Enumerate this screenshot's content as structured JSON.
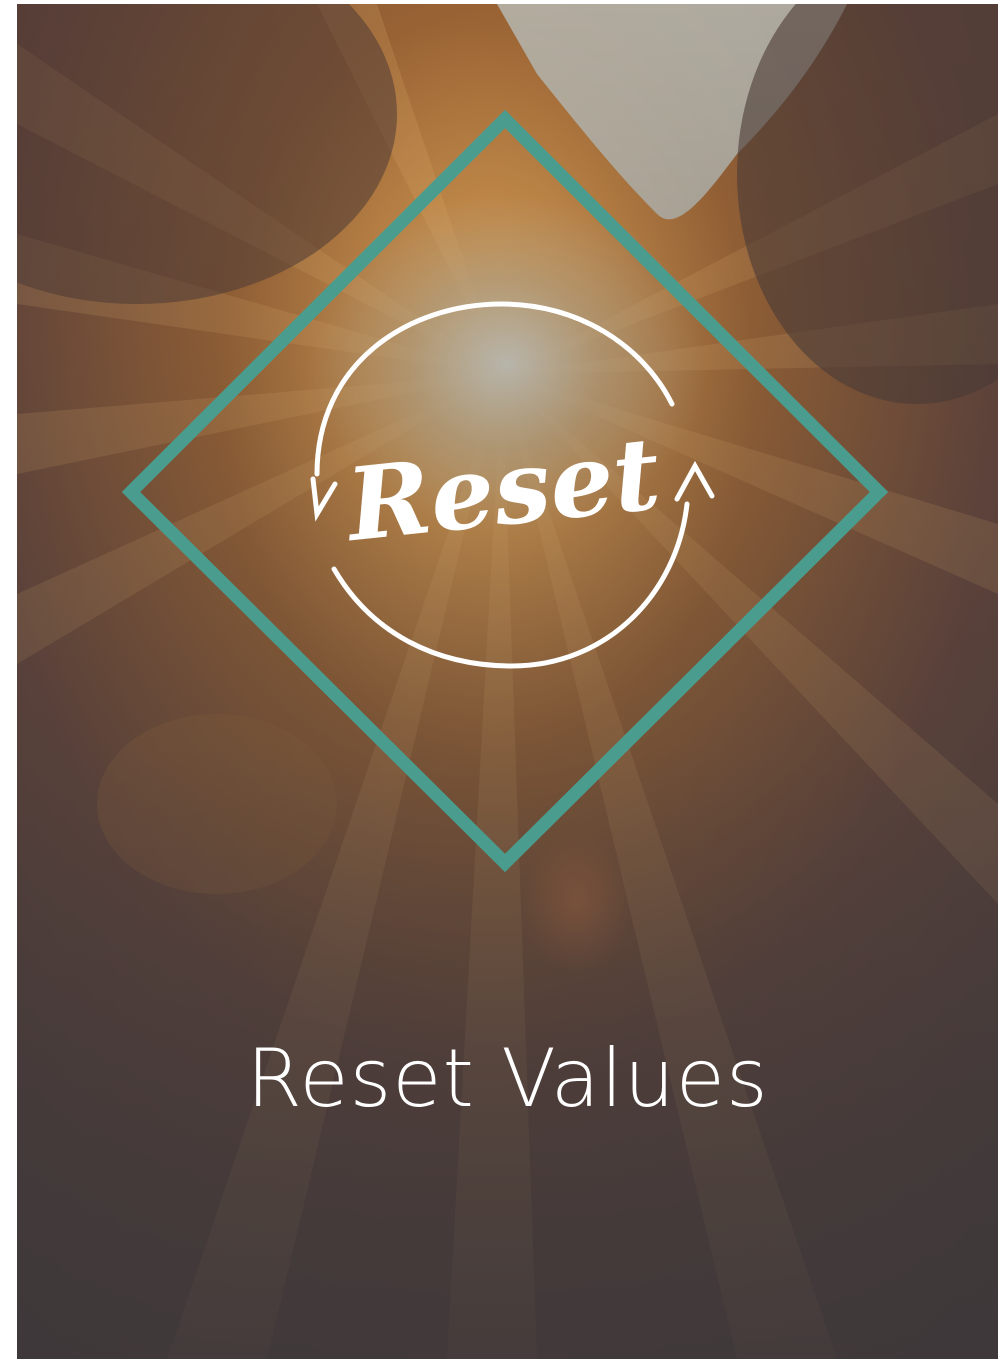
{
  "poster": {
    "logo_text": "Reset",
    "title": "Reset Values"
  },
  "colors": {
    "diamond_stroke": "#4a9d8e",
    "text": "#ffffff",
    "sun": "#f3b35a",
    "sky": "#b9b9b2",
    "shadow": "#4b4446"
  },
  "icons": {
    "logo": "circular-arrows-icon"
  }
}
